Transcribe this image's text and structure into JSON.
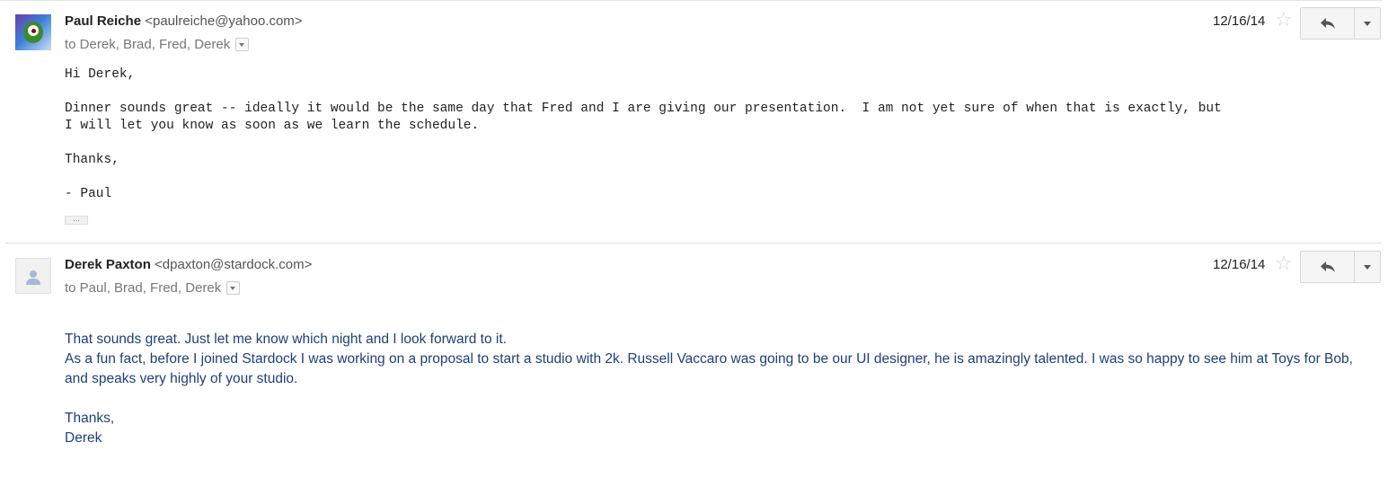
{
  "messages": [
    {
      "sender_name": "Paul Reiche",
      "sender_email": "<paulreiche@yahoo.com>",
      "recipients": "to Derek, Brad, Fred, Derek",
      "date": "12/16/14",
      "body_lines": [
        "Hi Derek,",
        "",
        "Dinner sounds great -- ideally it would be the same day that Fred and I are giving our presentation.  I am not yet sure of when that is exactly, but",
        "I will let you know as soon as we learn the schedule.",
        "",
        "Thanks,",
        "",
        "- Paul"
      ],
      "trimmed_content_label": "..."
    },
    {
      "sender_name": "Derek Paxton",
      "sender_email": "<dpaxton@stardock.com>",
      "recipients": "to Paul, Brad, Fred, Derek",
      "date": "12/16/14",
      "body": {
        "line1": "That sounds great. Just let me know which night and I look forward to it.",
        "line2": "As a fun fact, before I joined Stardock I was working on a proposal to start a studio with 2k. Russell Vaccaro was going to be our UI designer, he is amazingly talented. I was so happy to see him at Toys for Bob, and speaks very highly of your studio.",
        "signoff": "Thanks,",
        "signature": "Derek"
      }
    }
  ],
  "icons": {
    "star": "star-outline-icon",
    "reply": "reply-arrow-icon",
    "more": "dropdown-caret-icon",
    "show_details": "show-details-caret-icon"
  },
  "colors": {
    "body2_text": "#1f3f7a",
    "star": "#d4d4d4"
  }
}
